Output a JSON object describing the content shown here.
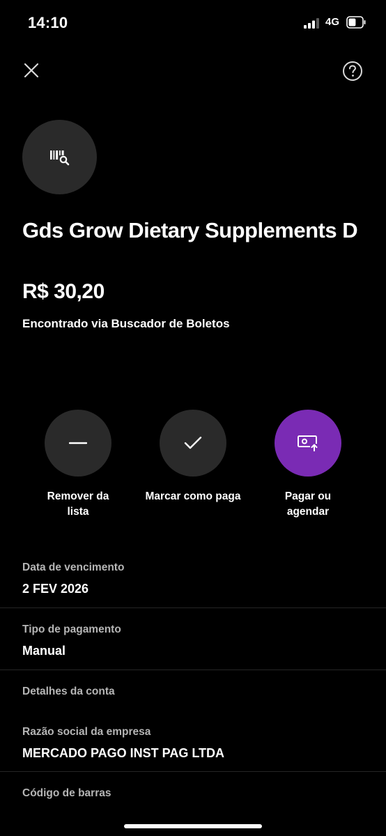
{
  "status_bar": {
    "time": "14:10",
    "network": "4G",
    "battery_level": 0.55
  },
  "nav": {
    "close_icon": "close-icon",
    "help_icon": "help-icon"
  },
  "bill": {
    "icon": "barcode-search-icon",
    "title": "Gds Grow Dietary Supplements D",
    "amount": "R$ 30,20",
    "source": "Encontrado via Buscador de Boletos"
  },
  "actions": [
    {
      "label": "Remover da lista",
      "icon": "minus-icon"
    },
    {
      "label": "Marcar como paga",
      "icon": "check-icon"
    },
    {
      "label": "Pagar ou agendar",
      "icon": "pay-schedule-icon",
      "color": "#7a2bb4"
    }
  ],
  "details": {
    "due_date_label": "Data de vencimento",
    "due_date_value": "2 FEV 2026",
    "payment_type_label": "Tipo de pagamento",
    "payment_type_value": "Manual",
    "account_details_label": "Detalhes da conta",
    "company_name_label": "Razão social da empresa",
    "company_name_value": "MERCADO PAGO INST PAG LTDA",
    "barcode_label": "Código de barras"
  },
  "colors": {
    "background": "#000000",
    "surface": "#2a2a2a",
    "accent": "#7a2bb4",
    "muted_text": "#b5b5b5"
  }
}
